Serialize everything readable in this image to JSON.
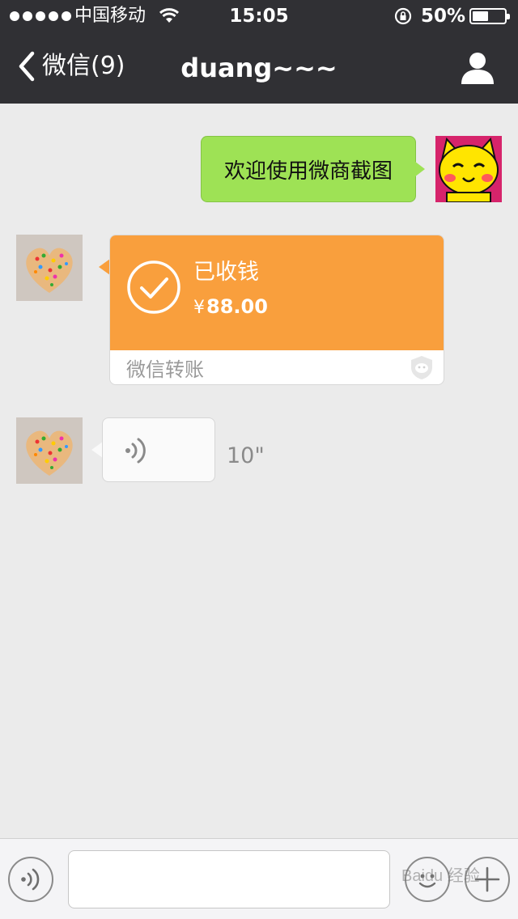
{
  "status_bar": {
    "carrier": "中国移动",
    "time": "15:05",
    "battery_text": "50%",
    "battery_level": 0.5
  },
  "nav": {
    "back_label": "微信(9)",
    "title": "duang~~~"
  },
  "messages": {
    "outgoing_text": "欢迎使用微商截图",
    "transfer": {
      "status": "已收钱",
      "currency": "¥",
      "amount": "88.00",
      "footer": "微信转账"
    },
    "voice": {
      "duration": "10\""
    }
  },
  "input": {
    "placeholder": ""
  },
  "watermark": "Baidu 经验",
  "colors": {
    "nav_bg": "#303034",
    "chat_bg": "#ebebeb",
    "outgoing_bubble": "#9ee255",
    "transfer_orange": "#f99f3d"
  },
  "icons": [
    "signal-dots",
    "wifi-icon",
    "rotation-lock-icon",
    "battery-icon",
    "back-chevron-icon",
    "profile-icon",
    "check-circle-icon",
    "shield-icon",
    "voice-wave-icon",
    "voice-toggle-icon",
    "emoji-icon",
    "plus-icon"
  ]
}
